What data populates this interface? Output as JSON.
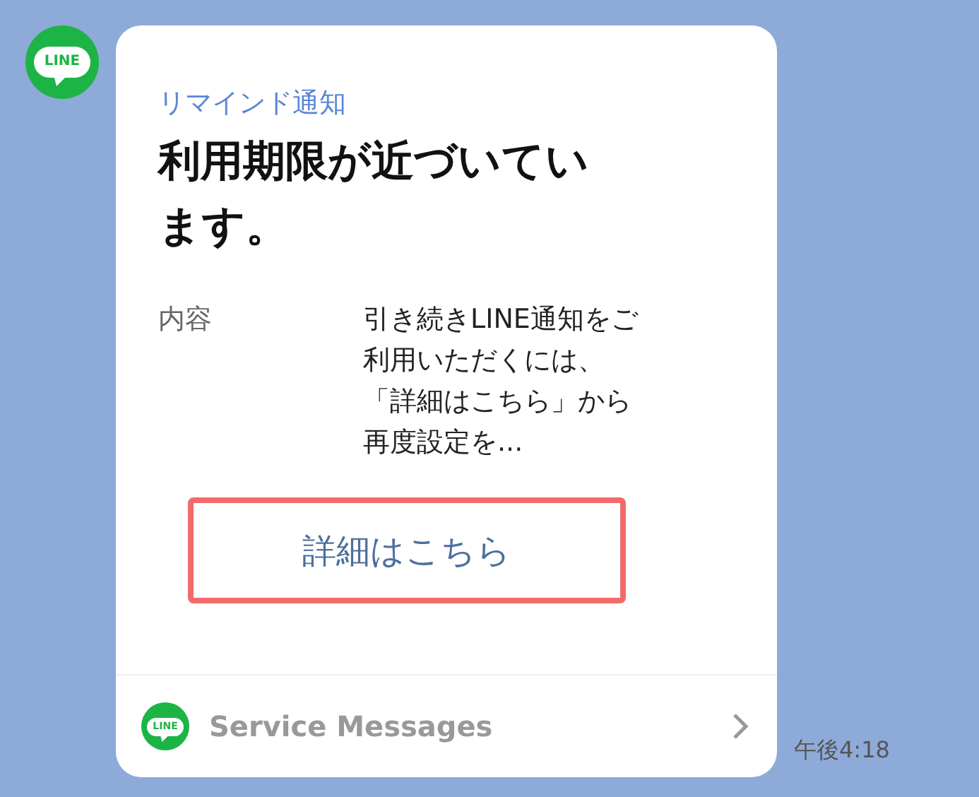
{
  "sender": {
    "logo_text": "LINE"
  },
  "card": {
    "label": "リマインド通知",
    "title_lines": [
      "利用期限が近づいてい",
      "ます。"
    ],
    "field": {
      "name": "内容",
      "value_lines": [
        "引き続きLINE通知をご",
        "利用いただくには、",
        "「詳細はこちら」から",
        "再度設定を..."
      ]
    },
    "button": {
      "label": "詳細はこちら",
      "highlighted": true
    },
    "footer": {
      "logo_text": "LINE",
      "label": "Service Messages"
    }
  },
  "time": "午後4:18"
}
